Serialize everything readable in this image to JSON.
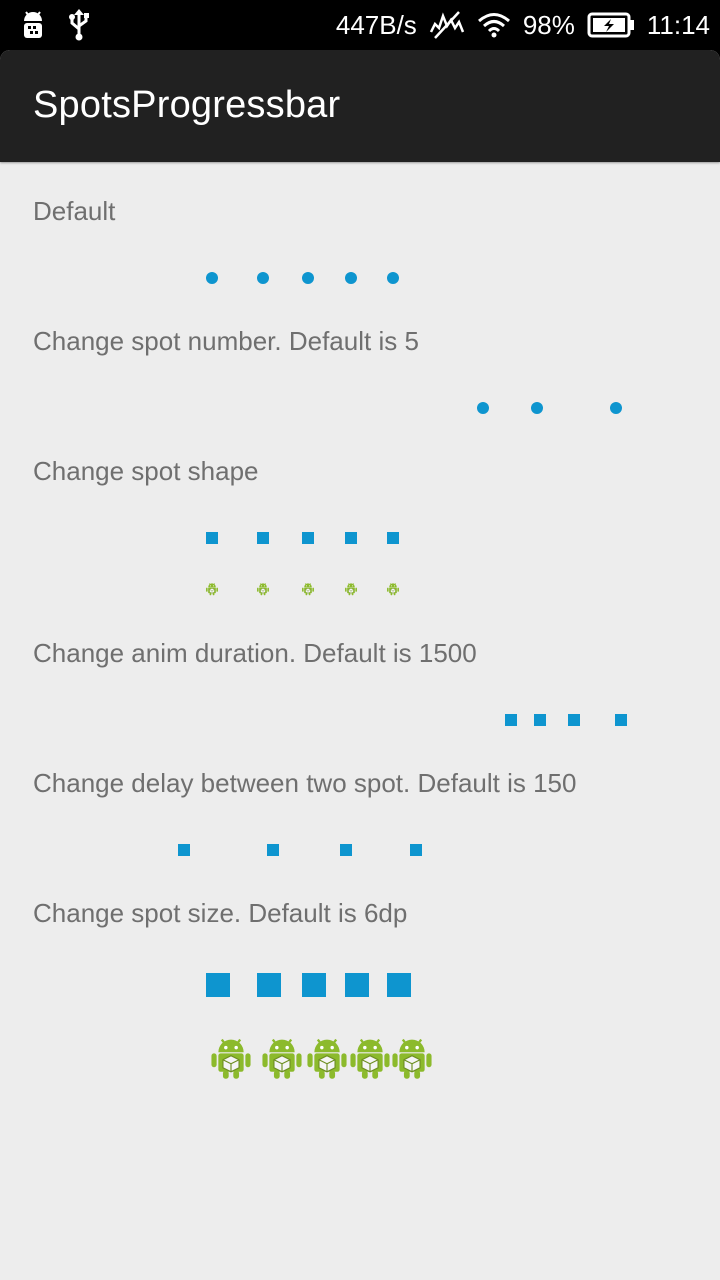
{
  "status_bar": {
    "left_icons": [
      "android-debug-icon",
      "usb-icon"
    ],
    "net_speed": "447B/s",
    "battery_percent": "98%",
    "time": "11:14",
    "right_icons": [
      "silent-mode-icon",
      "wifi-icon",
      "battery-charging-icon"
    ]
  },
  "app": {
    "title": "SpotsProgressbar"
  },
  "sections": [
    {
      "label": "Default",
      "spot_shape": "circle",
      "spot_count": 5,
      "spot_color": "#0e95cf"
    },
    {
      "label": "Change spot number. Default is 5",
      "spot_shape": "circle",
      "spot_count": 3,
      "spot_color": "#0e95cf"
    },
    {
      "label": "Change spot shape",
      "spot_shape": "square",
      "spot_count": 5,
      "spot_color": "#0e95cf",
      "extra_row": {
        "spot_shape": "android-icon",
        "spot_count": 5
      }
    },
    {
      "label": "Change anim duration. Default is 1500",
      "spot_shape": "square",
      "spot_count": 4,
      "spot_color": "#0e95cf"
    },
    {
      "label": "Change delay between two spot. Default is 150",
      "spot_shape": "square",
      "spot_count": 4,
      "spot_color": "#0e95cf"
    },
    {
      "label": "Change spot size. Default is 6dp",
      "spot_shape": "square",
      "spot_count": 5,
      "spot_color": "#0e95cf",
      "extra_row": {
        "spot_shape": "android-icon",
        "spot_count": 5
      }
    }
  ],
  "colors": {
    "accent": "#0e95cf",
    "action_bar": "#212121",
    "background": "#ededed",
    "label_text": "#6f6f6f"
  }
}
